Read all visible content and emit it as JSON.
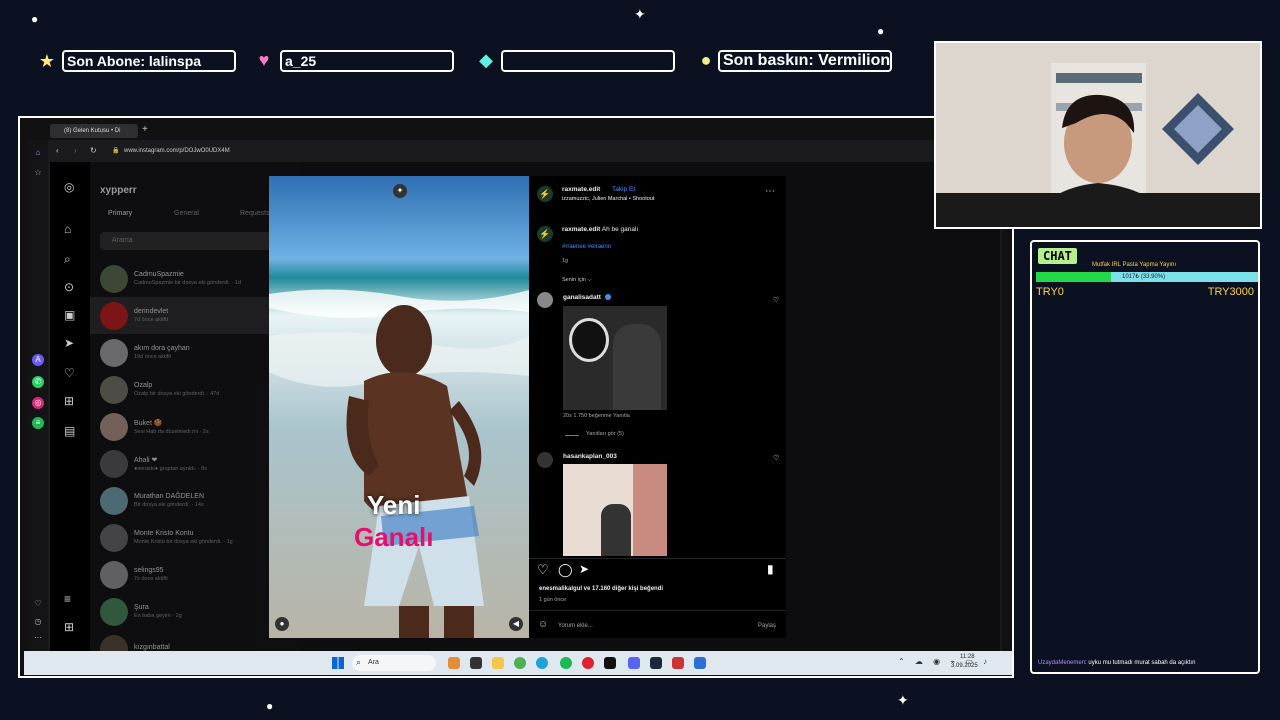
{
  "overlay": {
    "last_sub": "Son Abone: lalinspa",
    "last_donation": "a_25",
    "last_cheer": "",
    "last_raid": "Son baskın: Vermilionn"
  },
  "browser": {
    "tab_title": "(8) Gelen Kutusu • Di",
    "url": "www.instagram.com/p/DOJwO0UDX4M"
  },
  "ig": {
    "username": "xypperr",
    "tabs": [
      "Primary",
      "General",
      "Requests"
    ],
    "search_placeholder": "Arama",
    "dms": [
      {
        "name": "CadmuSpazmie",
        "sub": "CadmuSpazmie bir dosya eki gönderdi. · 1d"
      },
      {
        "name": "derindevlet",
        "sub": "7d önce aktifti"
      },
      {
        "name": "akım dora çayhan",
        "sub": "19d önce aktifti"
      },
      {
        "name": "Ozalp",
        "sub": "Ozalp bir dosya eki gönderdi. · 47d"
      },
      {
        "name": "Buket 🍪",
        "sub": "Sesi Hab da düzelmedi mi · 2s"
      },
      {
        "name": "Ahali ❤",
        "sub": "●seraski● gruptan ayrıldı. · 8s"
      },
      {
        "name": "Murathan DAĞDELEN",
        "sub": "Bir dosya eki gönderdi. · 14s"
      },
      {
        "name": "Monte Kristo Kontu",
        "sub": "Monte Kristo bir dosya eki gönderdi. · 1g"
      },
      {
        "name": "selings95",
        "sub": "7s önce aktifti"
      },
      {
        "name": "Şura",
        "sub": "En baba geyim · 2g"
      },
      {
        "name": "kızgınbattal",
        "sub": ""
      }
    ]
  },
  "post": {
    "overlay_line1": "Yeni",
    "overlay_line2": "Ganalı",
    "author": "raxmate.edit",
    "follow": "Takip Et",
    "audio": "izzamuzzic, Julien Marchal • Shootout",
    "caption_user": "raxmate.edit",
    "caption_text": "Ah be ganalı",
    "hashtags": "#rraenee #elraenn",
    "caption_time": "1g",
    "for_you": "Senin için ⌵",
    "comment1_user": "ganalisadatt",
    "comment1_meta": "20s   1.750 beğenme   Yanıtla",
    "view_replies": "Yanıtları gör (5)",
    "comment2_user": "hasankaplan_003",
    "likes": "enesmalikalgul ve 17.160 diğer kişi beğendi",
    "time_ago": "1 gün önce",
    "comment_placeholder": "Yorum ekle...",
    "post_button": "Paylaş"
  },
  "taskbar": {
    "search": "Ara",
    "time": "11:28",
    "date": "3.09.2025"
  },
  "chat": {
    "title": "CHAT",
    "goal_title": "Mutfak IRL Pasta Yapma Yayını",
    "goal_progress_text": "1017₺ (33.90%)",
    "goal_fraction": 0.339,
    "goal_start": "TRY0",
    "goal_end": "TRY3000",
    "message_user": "UzaydaMenemen",
    "message_text": ": uyku mu tutmadı murat sabah da açıktın"
  }
}
